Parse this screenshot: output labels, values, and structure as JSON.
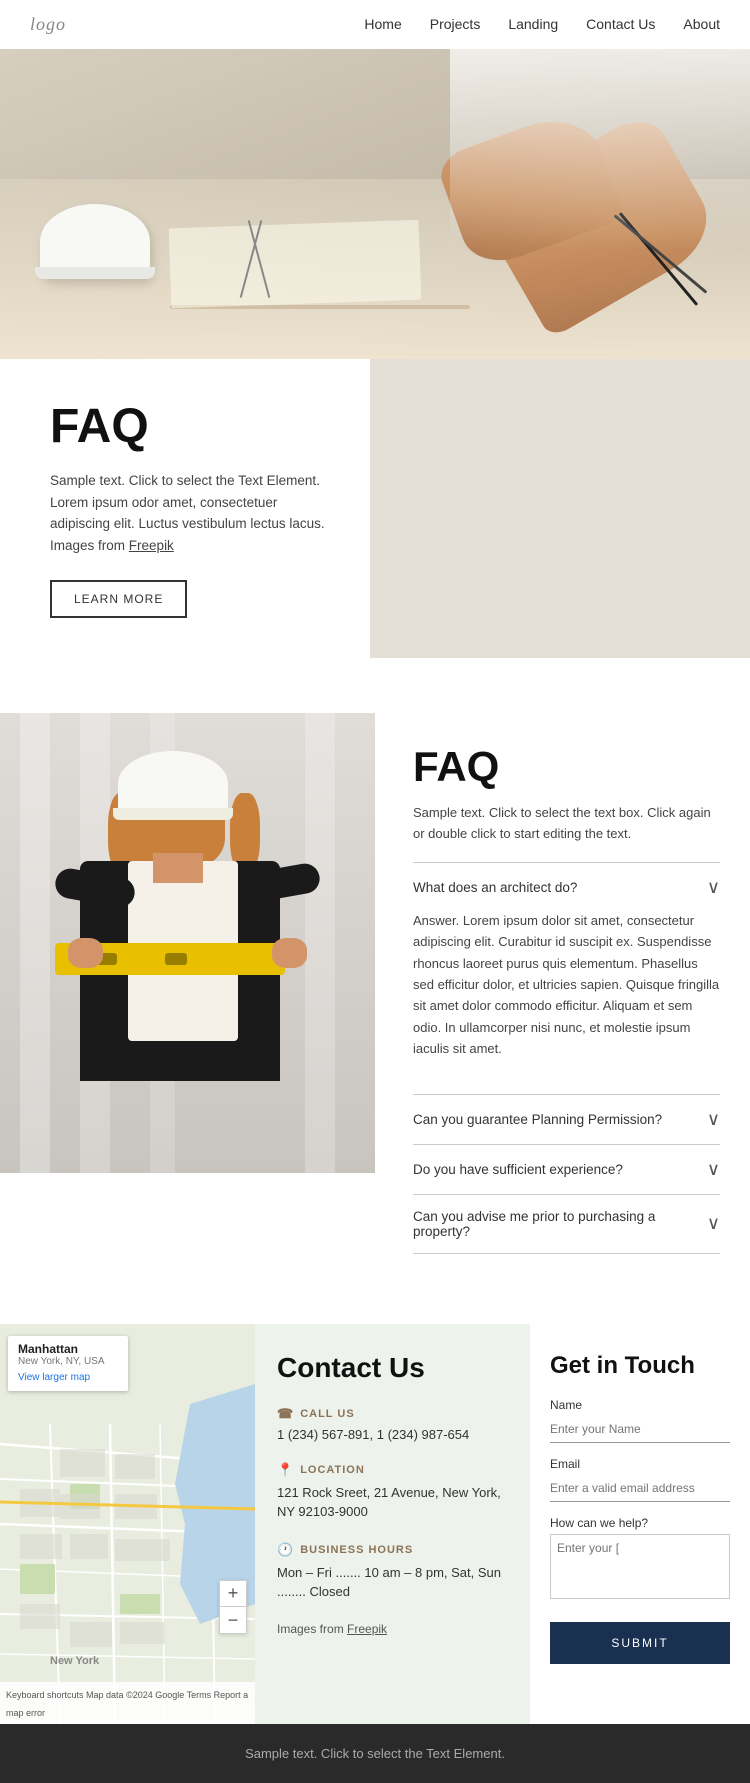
{
  "navbar": {
    "logo": "logo",
    "links": [
      "Home",
      "Projects",
      "Landing",
      "Contact Us",
      "About"
    ]
  },
  "hero": {
    "alt": "Architect working on blueprints at desk"
  },
  "faq_card": {
    "title": "FAQ",
    "description": "Sample text. Click to select the Text Element. Lorem ipsum odor amet, consectetuer adipiscing elit. Luctus vestibulum lectus lacus. Images from",
    "freepik_link": "Freepik",
    "learn_more_label": "LEARN MORE"
  },
  "faq_section": {
    "title": "FAQ",
    "intro": "Sample text. Click to select the text box. Click again or double click to start editing the text.",
    "items": [
      {
        "question": "What does an architect do?",
        "answer": "Answer. Lorem ipsum dolor sit amet, consectetur adipiscing elit. Curabitur id suscipit ex. Suspendisse rhoncus laoreet purus quis elementum. Phasellus sed efficitur dolor, et ultricies sapien. Quisque fringilla sit amet dolor commodo efficitur. Aliquam et sem odio. In ullamcorper nisi nunc, et molestie ipsum iaculis sit amet.",
        "open": true
      },
      {
        "question": "Can you guarantee Planning Permission?",
        "answer": "",
        "open": false
      },
      {
        "question": "Do you have sufficient experience?",
        "answer": "",
        "open": false
      },
      {
        "question": "Can you advise me prior to purchasing a property?",
        "answer": "",
        "open": false
      }
    ]
  },
  "contact": {
    "title": "Contact Us",
    "call_title": "CALL US",
    "call_number": "1 (234) 567-891, 1 (234) 987-654",
    "location_title": "LOCATION",
    "location_address": "121 Rock Sreet, 21 Avenue, New York, NY 92103-9000",
    "hours_title": "BUSINESS HOURS",
    "hours_text": "Mon – Fri ....... 10 am – 8 pm, Sat, Sun ........ Closed",
    "images_note": "Images from",
    "freepik_link": "Freepik"
  },
  "get_in_touch": {
    "title": "Get in Touch",
    "name_label": "Name",
    "name_placeholder": "Enter your Name",
    "email_label": "Email",
    "email_placeholder": "Enter a valid email address",
    "message_label": "How can we help?",
    "message_placeholder": "Enter your [",
    "submit_label": "SUBMIT"
  },
  "map": {
    "location_name": "Manhattan",
    "location_sub": "New York, NY, USA",
    "view_larger_label": "View larger map",
    "zoom_in": "+",
    "zoom_out": "−",
    "footer_text": "Keyboard shortcuts  Map data ©2024 Google  Terms  Report a map error"
  },
  "footer": {
    "text": "Sample text. Click to select the Text Element."
  },
  "icons": {
    "phone": "☎",
    "location": "📍",
    "clock": "🕐",
    "chevron_down": "∨"
  }
}
